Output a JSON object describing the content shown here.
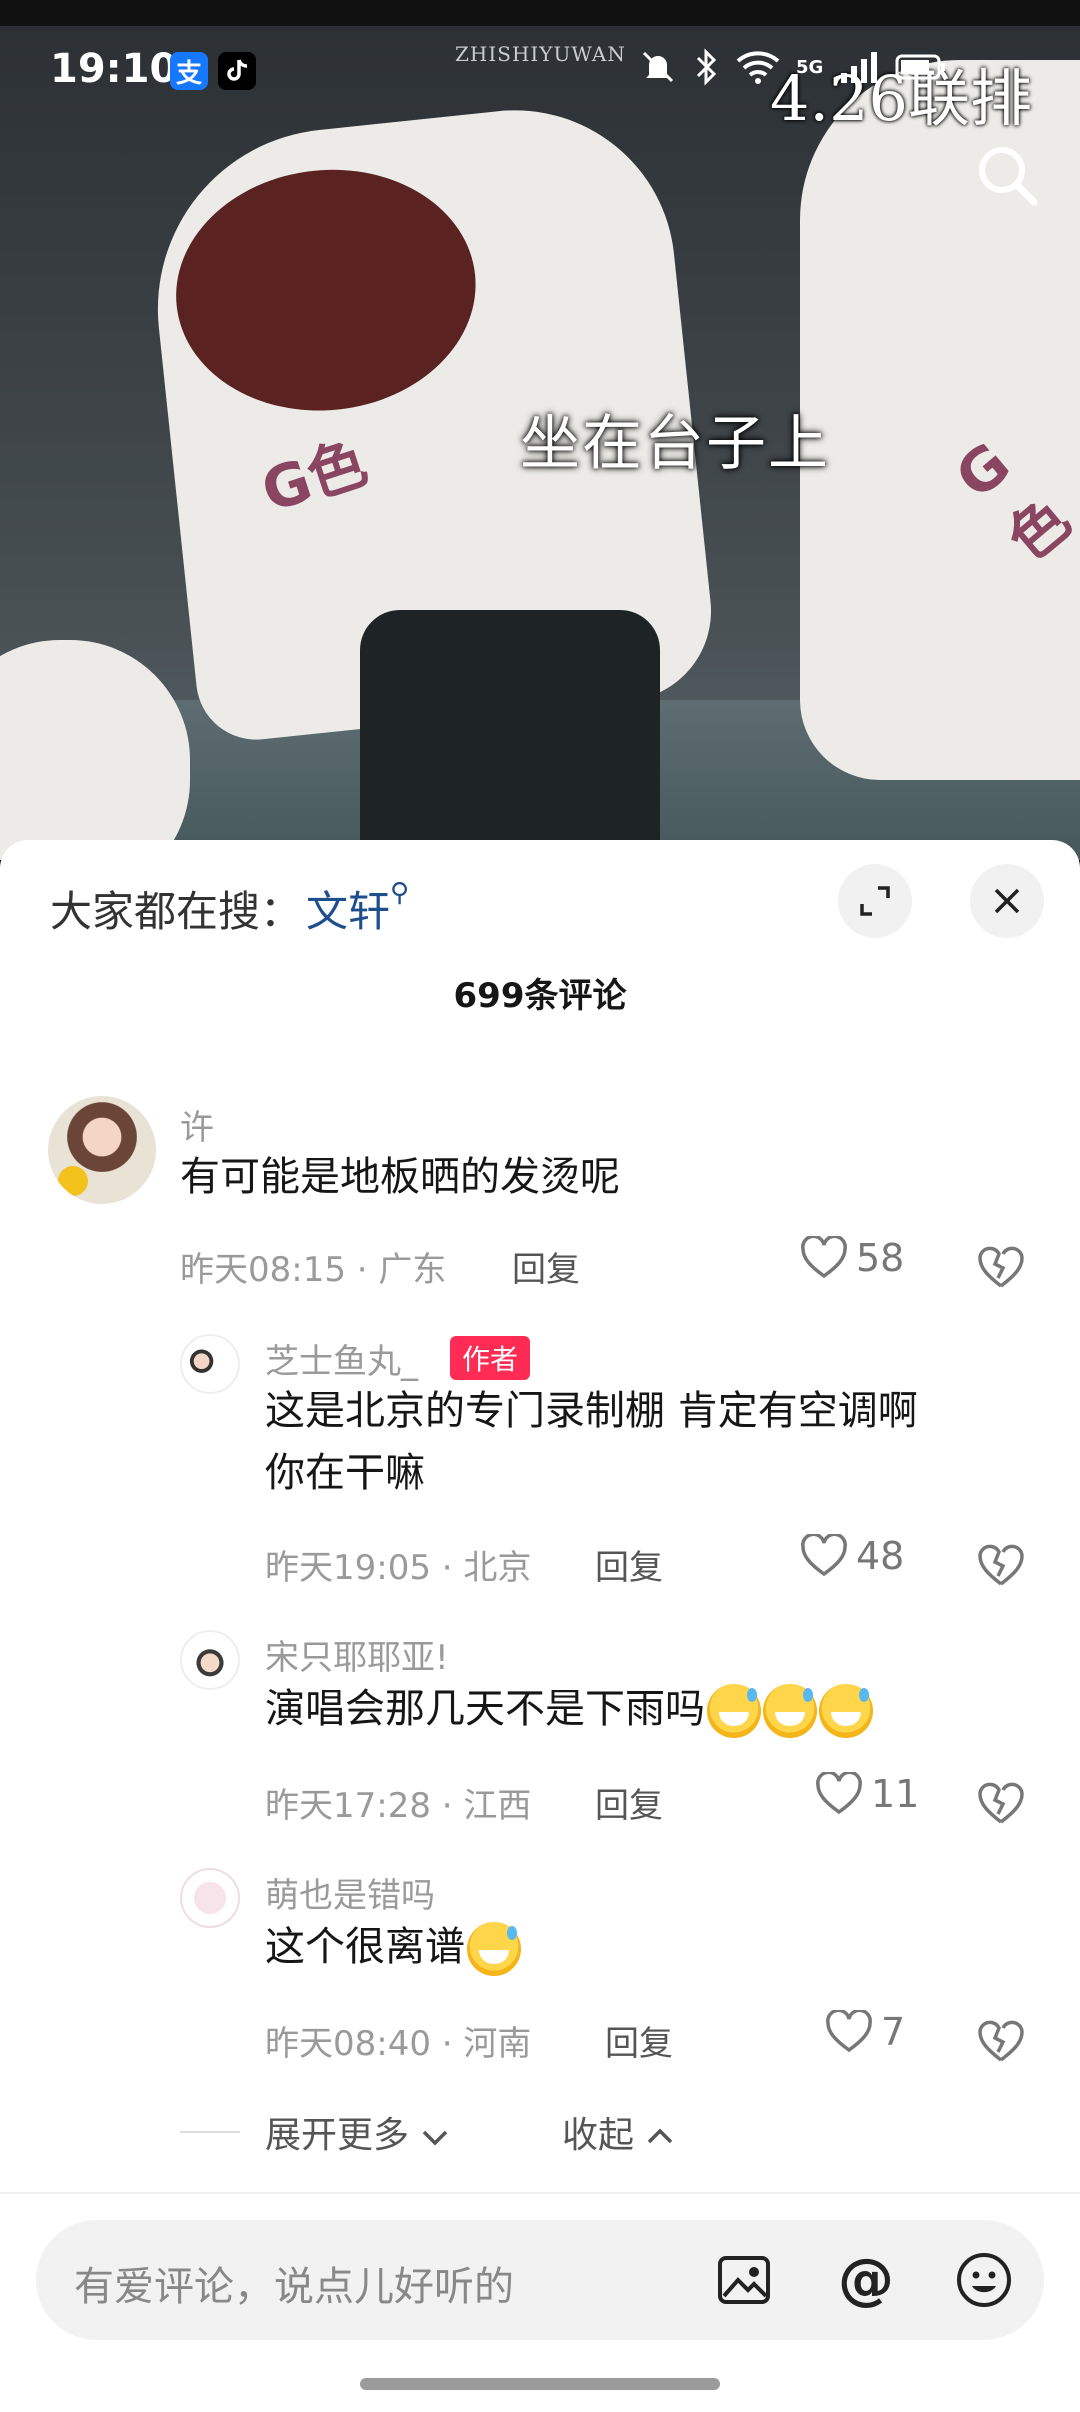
{
  "status_bar": {
    "time": "19:10",
    "alipay_badge": "支",
    "network": "5G",
    "icons": [
      "mute-bell-icon",
      "bluetooth-icon",
      "wifi-icon",
      "signal-icon",
      "battery-icon"
    ]
  },
  "video": {
    "watermark": "ZHISHIYUWAN",
    "title": "4.26联排",
    "caption": "坐在台子上",
    "shirt_print": "G色"
  },
  "sheet": {
    "search_hint_label": "大家都在搜：",
    "search_hint_term": "文轩",
    "comment_count": "699条评论"
  },
  "comments": [
    {
      "user": "许",
      "text": "有可能是地板晒的发烫呢",
      "time_loc": "昨天08:15 · 广东",
      "reply_label": "回复",
      "likes": "58"
    }
  ],
  "replies": [
    {
      "user": "芝士鱼丸_",
      "author_tag": "作者",
      "text_line1": "这是北京的专门录制棚 肯定有空调啊",
      "text_line2": "你在干嘛",
      "time_loc": "昨天19:05 · 北京",
      "reply_label": "回复",
      "likes": "48"
    },
    {
      "user": "宋只耶耶亚!",
      "text": "演唱会那几天不是下雨吗",
      "time_loc": "昨天17:28 · 江西",
      "reply_label": "回复",
      "likes": "11"
    },
    {
      "user": "萌也是错吗",
      "text": "这个很离谱",
      "time_loc": "昨天08:40 · 河南",
      "reply_label": "回复",
      "likes": "7"
    }
  ],
  "thread_controls": {
    "expand_more": "展开更多",
    "collapse": "收起"
  },
  "input": {
    "placeholder": "有爱评论，说点儿好听的",
    "at_symbol": "@"
  },
  "colors": {
    "accent_link": "#1f4e8c",
    "author_tag": "#fe2c55"
  }
}
